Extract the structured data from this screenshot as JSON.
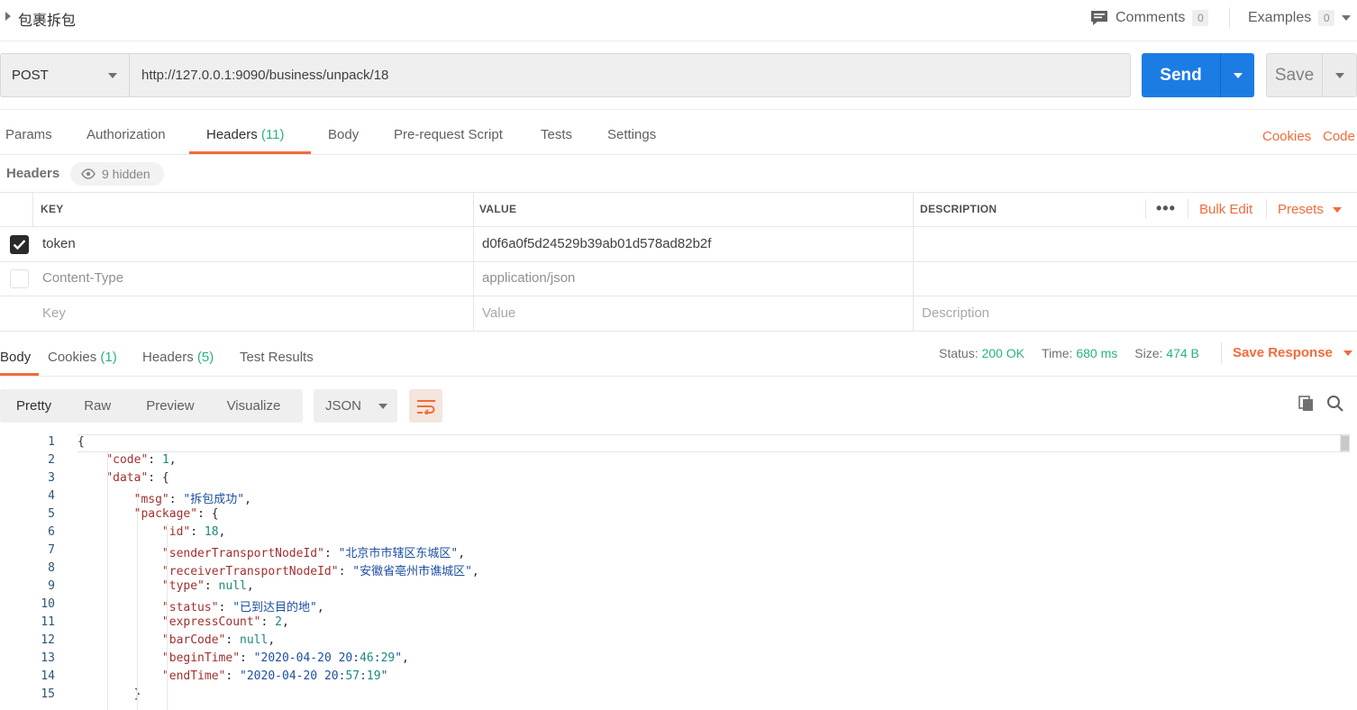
{
  "title": "包裹拆包",
  "comments": {
    "label": "Comments",
    "count": "0"
  },
  "examples": {
    "label": "Examples",
    "count": "0"
  },
  "request": {
    "method": "POST",
    "url": "http://127.0.0.1:9090/business/unpack/18",
    "send_label": "Send",
    "save_label": "Save"
  },
  "req_tabs": {
    "params": "Params",
    "authorization": "Authorization",
    "headers": "Headers",
    "headers_count": "(11)",
    "body": "Body",
    "prerequest": "Pre-request Script",
    "tests": "Tests",
    "settings": "Settings",
    "cookies": "Cookies",
    "code": "Code"
  },
  "headers_section": {
    "label": "Headers",
    "hidden": "9 hidden"
  },
  "table": {
    "col_key": "KEY",
    "col_value": "VALUE",
    "col_description": "DESCRIPTION",
    "dots": "•••",
    "bulk_edit": "Bulk Edit",
    "presets": "Presets",
    "rows": [
      {
        "key": "token",
        "value": "d0f6a0f5d24529b39ab01d578ad82b2f",
        "checked": true
      },
      {
        "key": "Content-Type",
        "value": "application/json",
        "checked": false
      }
    ],
    "placeholder": {
      "key": "Key",
      "value": "Value",
      "description": "Description"
    }
  },
  "resp_tabs": {
    "body": "Body",
    "cookies": "Cookies",
    "cookies_count": "(1)",
    "headers": "Headers",
    "headers_count": "(5)",
    "test_results": "Test Results"
  },
  "response_meta": {
    "status_label": "Status:",
    "status": "200 OK",
    "time_label": "Time:",
    "time": "680 ms",
    "size_label": "Size:",
    "size": "474 B",
    "save_response": "Save Response"
  },
  "view": {
    "pretty": "Pretty",
    "raw": "Raw",
    "preview": "Preview",
    "visualize": "Visualize",
    "format": "JSON"
  },
  "code_lines": [
    {
      "n": "1",
      "html": "{"
    },
    {
      "n": "2",
      "html": "    \"code\": 1,"
    },
    {
      "n": "3",
      "html": "    \"data\": {"
    },
    {
      "n": "4",
      "html": "        \"msg\": \"拆包成功\","
    },
    {
      "n": "5",
      "html": "        \"package\": {"
    },
    {
      "n": "6",
      "html": "            \"id\": 18,"
    },
    {
      "n": "7",
      "html": "            \"senderTransportNodeId\": \"北京市市辖区东城区\","
    },
    {
      "n": "8",
      "html": "            \"receiverTransportNodeId\": \"安徽省亳州市谯城区\","
    },
    {
      "n": "9",
      "html": "            \"type\": null,"
    },
    {
      "n": "10",
      "html": "            \"status\": \"已到达目的地\","
    },
    {
      "n": "11",
      "html": "            \"expressCount\": 2,"
    },
    {
      "n": "12",
      "html": "            \"barCode\": null,"
    },
    {
      "n": "13",
      "html": "            \"beginTime\": \"2020-04-20 20:46:29\","
    },
    {
      "n": "14",
      "html": "            \"endTime\": \"2020-04-20 20:57:19\""
    },
    {
      "n": "15",
      "html": "        }"
    }
  ],
  "colors": {
    "accent": "#f26b3a",
    "send": "#1b7ce4",
    "ok": "#26b47f"
  }
}
